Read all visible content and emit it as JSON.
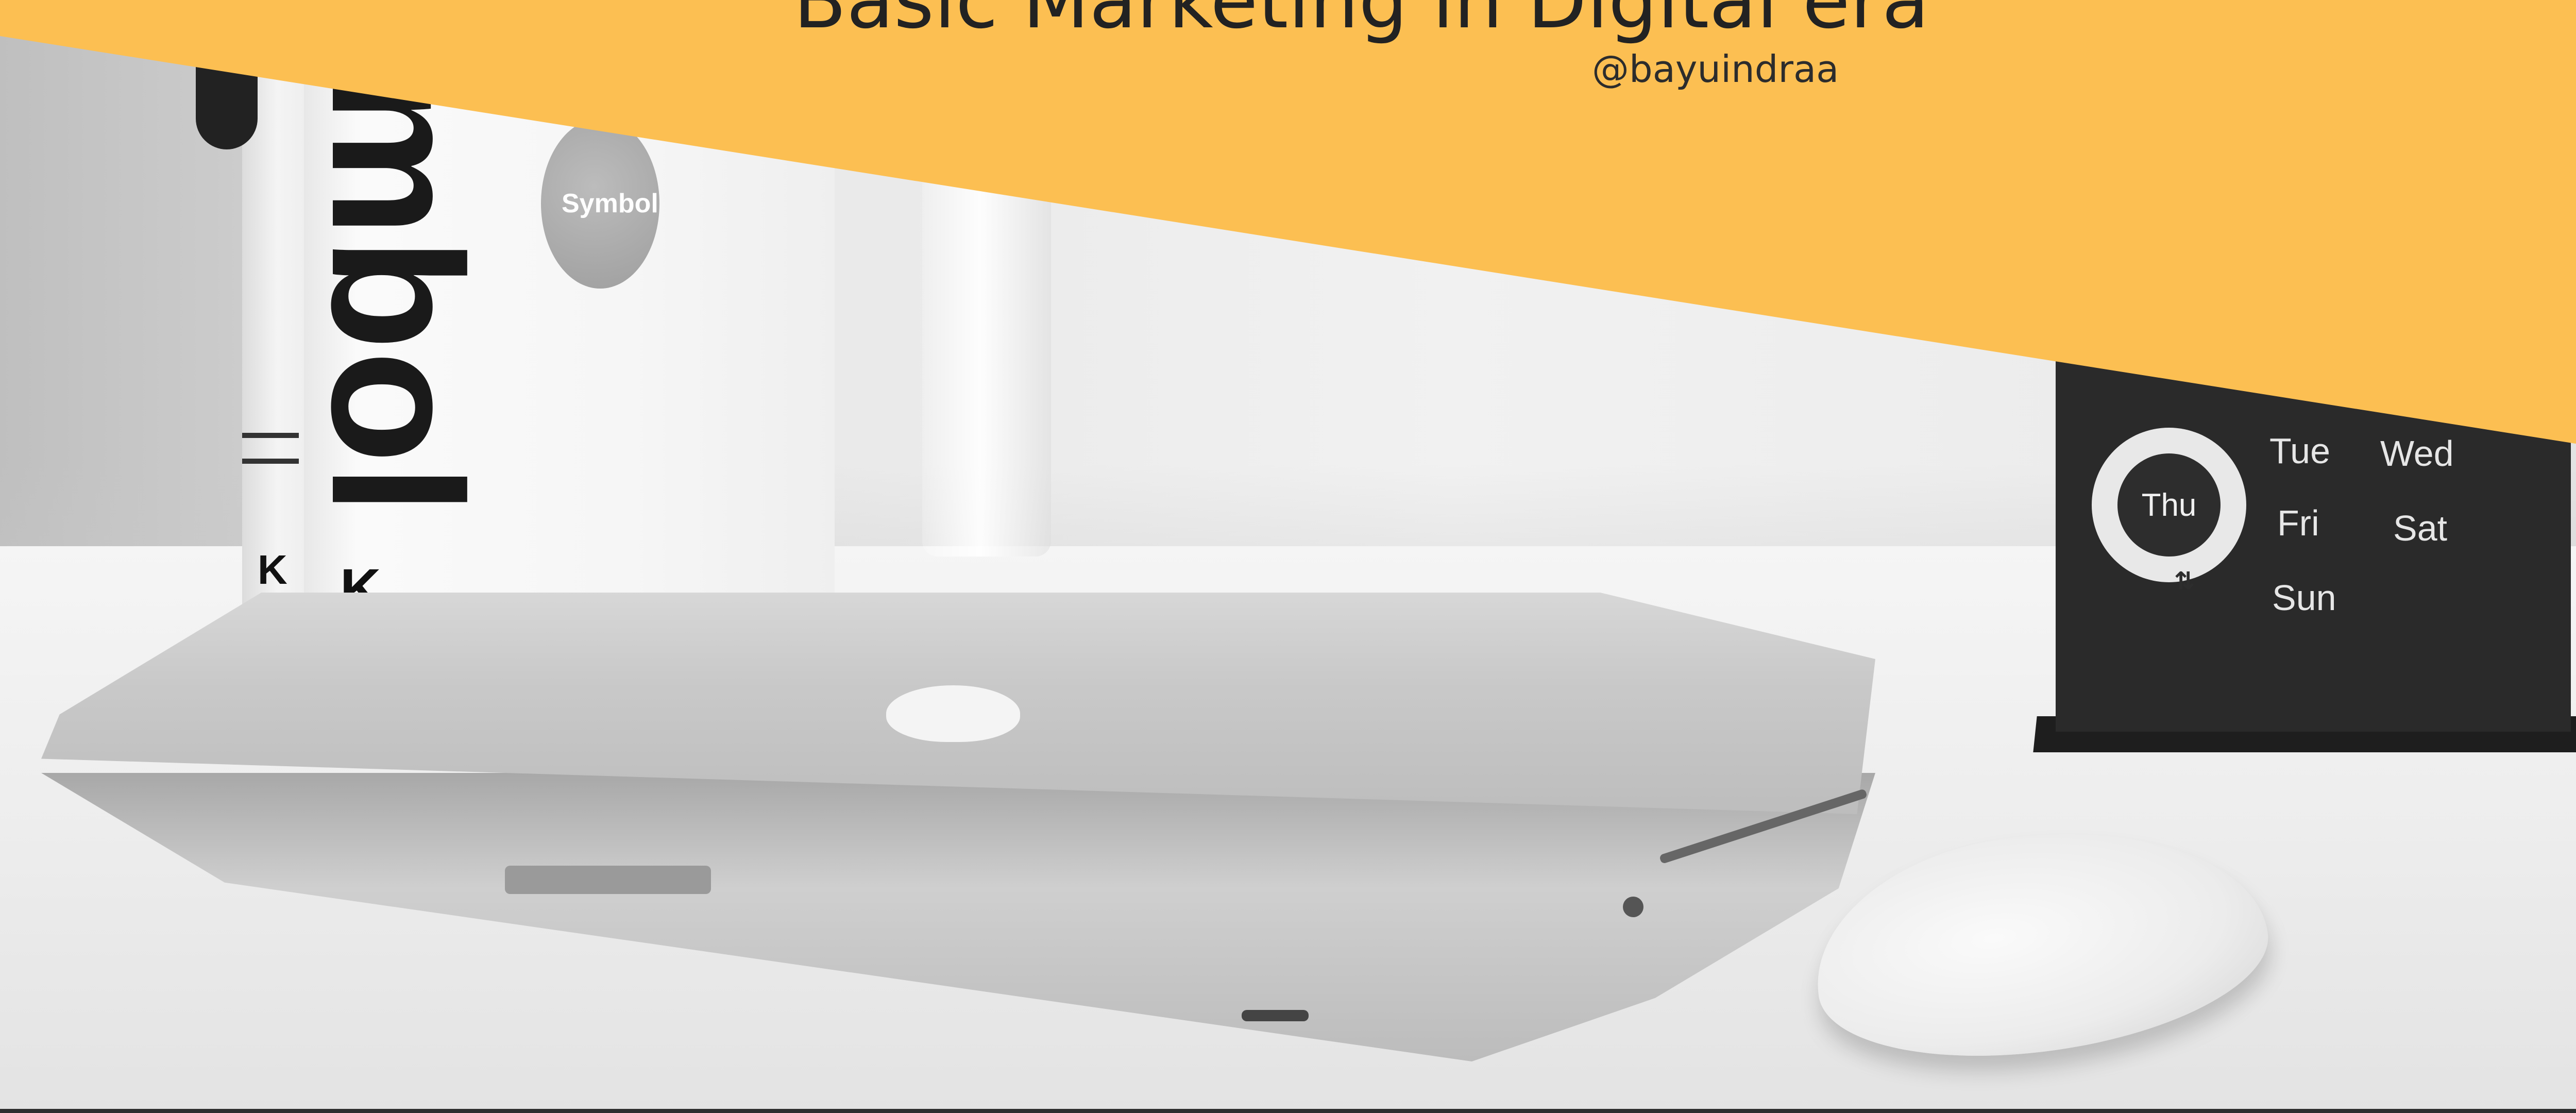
{
  "slide": {
    "title": "Basic Marketing in Digital era",
    "author": "@bayuindraa",
    "banner_color": "#FCBF52"
  },
  "photo": {
    "book_spine": "mbol",
    "book_publisher_mark": "K",
    "sticker_text": "Symbol",
    "clock": {
      "center_day": "Thu",
      "days": [
        "Tue",
        "Wed",
        "Fri",
        "Sat",
        "Sun"
      ]
    }
  }
}
